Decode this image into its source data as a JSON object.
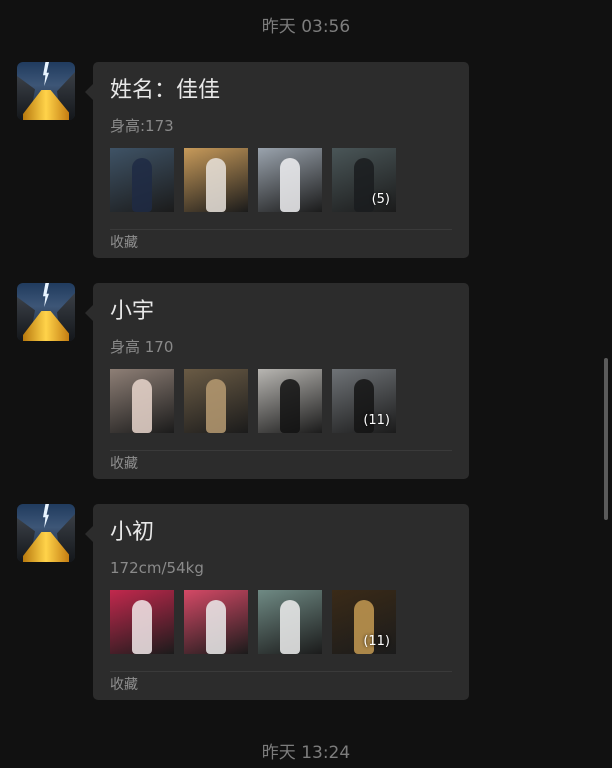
{
  "timestamps": {
    "top": "昨天 03:56",
    "bottom": "昨天 13:24"
  },
  "avatar_icon": "lightning-river-landscape",
  "messages": [
    {
      "title": "姓名：佳佳",
      "subtitle": "身高:173",
      "footer": "收藏",
      "photos": [
        {
          "bg": "#3f5366",
          "fg": "#1e2a44",
          "count": ""
        },
        {
          "bg": "#c79a5a",
          "fg": "#e9e3dc",
          "count": ""
        },
        {
          "bg": "#9aa3ad",
          "fg": "#f0f0f2",
          "count": ""
        },
        {
          "bg": "#4a5658",
          "fg": "#1a1c1e",
          "count": "(5)"
        }
      ]
    },
    {
      "title": "小宇",
      "subtitle": "身高 170",
      "footer": "收藏",
      "photos": [
        {
          "bg": "#8e7f76",
          "fg": "#e9d6cc",
          "count": ""
        },
        {
          "bg": "#6a5b45",
          "fg": "#b79b72",
          "count": ""
        },
        {
          "bg": "#b8b6b2",
          "fg": "#121212",
          "count": ""
        },
        {
          "bg": "#6f7377",
          "fg": "#141414",
          "count": "(11)"
        }
      ]
    },
    {
      "title": "小初",
      "subtitle": "172cm/54kg",
      "footer": "收藏",
      "photos": [
        {
          "bg": "#c2284d",
          "fg": "#f2e9ea",
          "count": ""
        },
        {
          "bg": "#d44966",
          "fg": "#ececec",
          "count": ""
        },
        {
          "bg": "#6f8a84",
          "fg": "#efefef",
          "count": ""
        },
        {
          "bg": "#3a2a17",
          "fg": "#c49a52",
          "count": "(11)"
        }
      ]
    }
  ]
}
